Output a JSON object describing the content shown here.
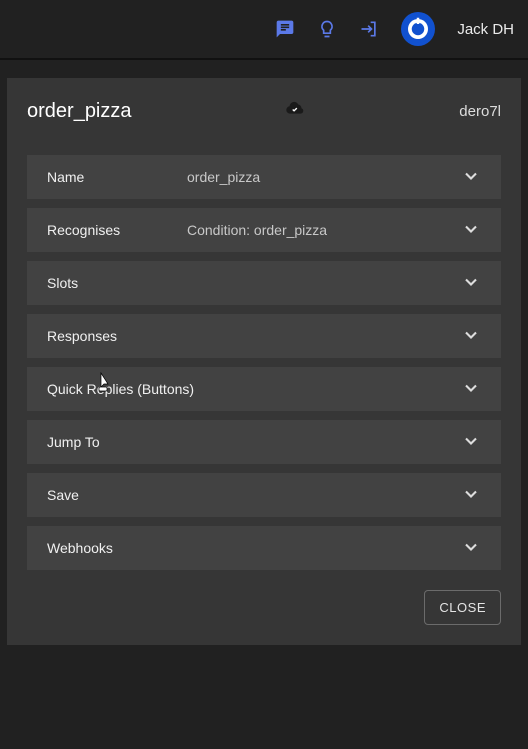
{
  "header": {
    "user_name": "Jack DH"
  },
  "panel": {
    "title": "order_pizza",
    "code": "dero7l",
    "rows": [
      {
        "label": "Name",
        "value": "order_pizza"
      },
      {
        "label": "Recognises",
        "value": "Condition: order_pizza"
      },
      {
        "label": "Slots"
      },
      {
        "label": "Responses"
      },
      {
        "label": "Quick Replies (Buttons)"
      },
      {
        "label": "Jump To"
      },
      {
        "label": "Save"
      },
      {
        "label": "Webhooks"
      }
    ],
    "close_label": "CLOSE"
  }
}
